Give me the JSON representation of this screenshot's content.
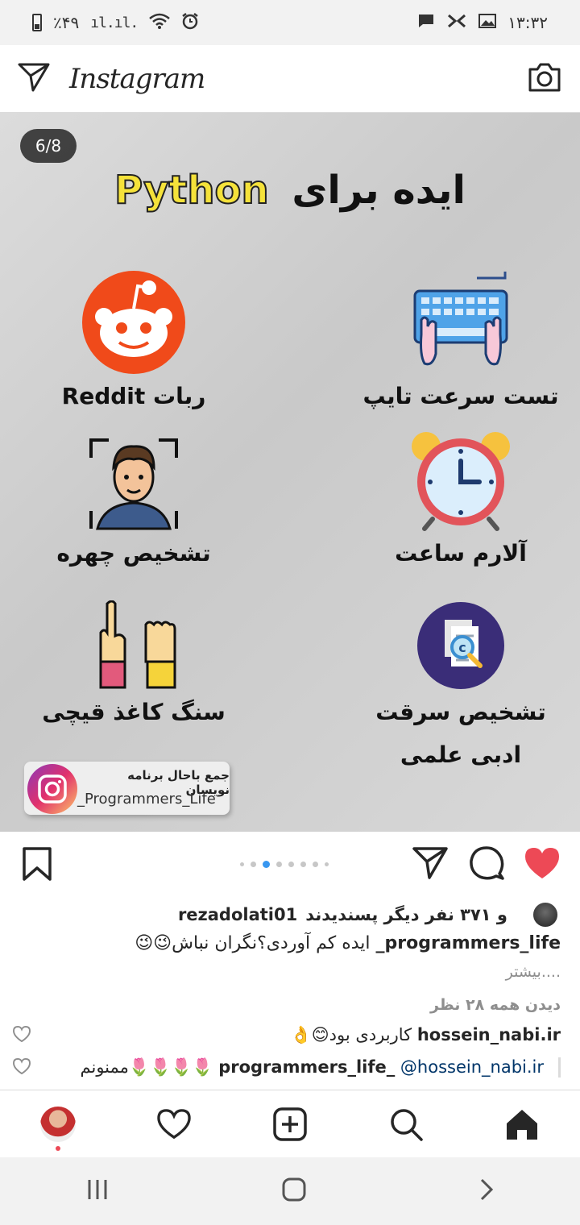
{
  "status_bar": {
    "battery": "٪۴۹",
    "time": "۱۳:۳۲"
  },
  "header": {
    "logo": "Instagram"
  },
  "post": {
    "counter": "6/8",
    "title_python": "Python",
    "title_text": "ایده برای",
    "ideas": [
      "ربات Reddit",
      "تست سرعت تایپ",
      "تشخیص چهره",
      "آلارم ساعت",
      "سنگ کاغذ قیچی",
      "تشخیص سرقت",
      "ادبی علمی"
    ],
    "badge_line1": "جمع باحال برنامه نویسان",
    "badge_line2": "_Programmers_Life",
    "carousel": {
      "count": 8,
      "active": 6
    }
  },
  "likes": {
    "text": "و ۳۷۱ نفر دیگر پسندیدند",
    "username": "rezadolati01"
  },
  "caption": {
    "username": "programmers_life_",
    "text": "ایده کم آوردی؟نگران نباش😉😉",
    "more": "....بیشتر"
  },
  "comments": {
    "view_all": "دیدن همه ۲۸ نظر",
    "items": [
      {
        "username": "hossein_nabi.ir",
        "text": "کاربردی بود😊👌"
      },
      {
        "username": "programmers_life_",
        "mention": "@hossein_nabi.ir",
        "text": "🌷🌷🌷🌷ممنونم"
      }
    ]
  },
  "colors": {
    "like_red": "#ed4956",
    "active_dot": "#3897f0"
  }
}
